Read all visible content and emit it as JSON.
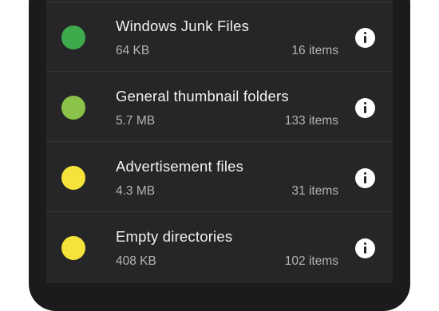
{
  "junk_categories": [
    {
      "title": "Windows Junk Files",
      "size": "64 KB",
      "items": "16 items",
      "color": "#3daa4c"
    },
    {
      "title": "General thumbnail folders",
      "size": "5.7 MB",
      "items": "133 items",
      "color": "#8bc34a"
    },
    {
      "title": "Advertisement files",
      "size": "4.3 MB",
      "items": "31 items",
      "color": "#f5e23a"
    },
    {
      "title": "Empty directories",
      "size": "408 KB",
      "items": "102 items",
      "color": "#f5e23a"
    }
  ],
  "icons": {
    "info": "info-icon"
  }
}
